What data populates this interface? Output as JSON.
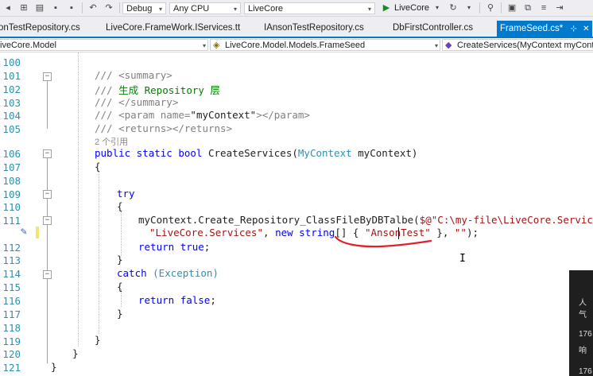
{
  "toolbar": {
    "config": "Debug",
    "platform": "Any CPU",
    "project": "LiveCore",
    "run_label": "LiveCore"
  },
  "tabs": [
    {
      "label": "onTestRepository.cs"
    },
    {
      "label": "LiveCore.FrameWork.IServices.tt"
    },
    {
      "label": "IAnsonTestRepository.cs"
    },
    {
      "label": "DbFirstController.cs"
    },
    {
      "label": "FrameSeed.cs*",
      "pin": "⊹",
      "close": "✕"
    }
  ],
  "nav": {
    "project": "iveCore.Model",
    "class": "LiveCore.Model.Models.FrameSeed",
    "member": "CreateServices(MyContext myConte"
  },
  "lines": [
    {
      "n": "100"
    },
    {
      "n": "101"
    },
    {
      "n": "102"
    },
    {
      "n": "103"
    },
    {
      "n": "104"
    },
    {
      "n": "105"
    },
    {
      "n": ""
    },
    {
      "n": "106"
    },
    {
      "n": "107"
    },
    {
      "n": "108"
    },
    {
      "n": "109"
    },
    {
      "n": "110"
    },
    {
      "n": "111"
    },
    {
      "n": ""
    },
    {
      "n": "112"
    },
    {
      "n": "113"
    },
    {
      "n": "114"
    },
    {
      "n": "115"
    },
    {
      "n": "116"
    },
    {
      "n": "117"
    },
    {
      "n": "118"
    },
    {
      "n": "119"
    },
    {
      "n": "120"
    },
    {
      "n": "121"
    }
  ],
  "code": {
    "l101a": "/// <summary>",
    "l102a": "/// ",
    "l102b": "生成 Repository 层",
    "l103a": "/// </summary>",
    "l104a": "/// <param name=",
    "l104b": "\"myContext\"",
    "l104c": "></param>",
    "l105a": "/// <returns></returns>",
    "ref": "2 个引用",
    "l106kw": "public static bool ",
    "l106m": "CreateServices(",
    "l106t": "MyContext",
    "l106p": " myContext)",
    "l107": "{",
    "l109": "try",
    "l110": "{",
    "l111a": "myContext.Create_Repository_ClassFileByDBTalbe(",
    "l111b": "$@\"C:\\my-file\\LiveCore.Services\"",
    "l111c": ",",
    "l111d1": "\"LiveCore.Services\"",
    "l111d2": ", ",
    "l111d3": "new string",
    "l111d4": "[] { ",
    "l111d5": "\"AnsonTest",
    "l111d6": "\"",
    "l111d7": " }, ",
    "l111d8": "\"\"",
    "l111d9": ");",
    "l112kw": "return ",
    "l112v": "true",
    "l112e": ";",
    "l113": "}",
    "l114kw": "catch ",
    "l114t": "(Exception)",
    "l115": "{",
    "l116kw": "return ",
    "l116v": "false",
    "l116e": ";",
    "l117": "}",
    "l119": "}",
    "l120": "}",
    "l121": "}"
  },
  "overlay": {
    "t1": "人气",
    "t2": "176",
    "t3": "响",
    "t4": "176"
  }
}
